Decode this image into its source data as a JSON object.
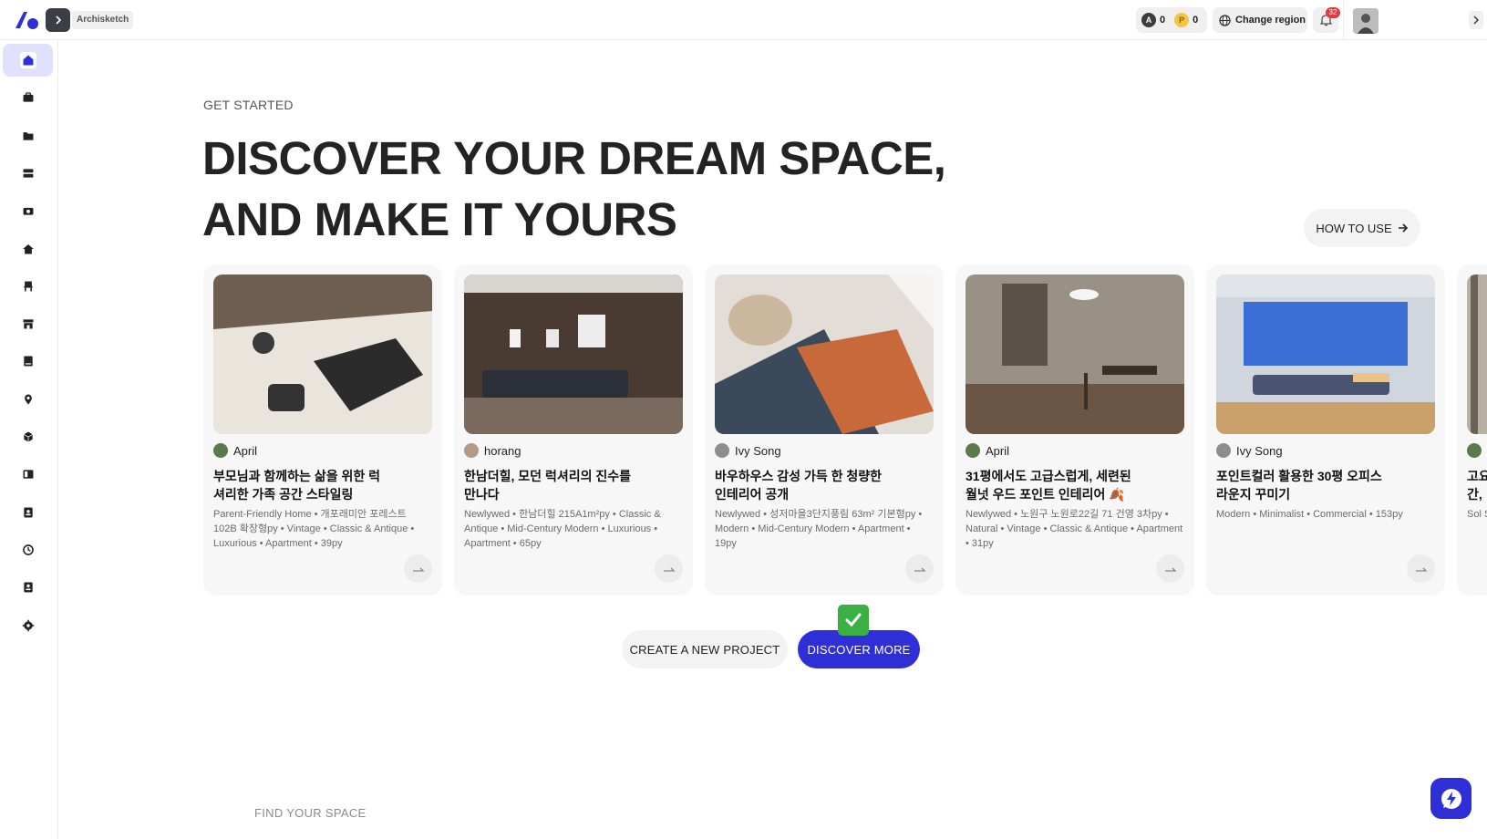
{
  "app": {
    "workspace_label": "Archisketch"
  },
  "topbar": {
    "credit_a_value": "0",
    "credit_p_letter": "P",
    "credit_p_value": "0",
    "region_label": "Change region",
    "notification_count": "32"
  },
  "sidebar": {
    "items": [
      {
        "icon": "home-icon",
        "active": true
      },
      {
        "icon": "briefcase-icon"
      },
      {
        "icon": "folder-icon"
      },
      {
        "icon": "storage-icon"
      },
      {
        "icon": "camera-icon"
      },
      {
        "icon": "house-icon"
      },
      {
        "icon": "chair-icon"
      },
      {
        "icon": "store-icon"
      },
      {
        "icon": "book-icon"
      },
      {
        "icon": "location-pin-icon"
      },
      {
        "icon": "cube-icon"
      },
      {
        "icon": "catalog-icon"
      },
      {
        "icon": "contact-card-icon"
      },
      {
        "icon": "history-icon"
      },
      {
        "icon": "id-badge-icon"
      },
      {
        "icon": "settings-icon"
      }
    ]
  },
  "hero": {
    "eyebrow": "GET STARTED",
    "headline_line1": "DISCOVER YOUR DREAM SPACE,",
    "headline_line2": "AND MAKE IT YOURS",
    "how_to_use": "HOW TO USE"
  },
  "cards": [
    {
      "author": "April",
      "title": "부모님과 함께하는 삶을 위한 럭셔리한 가족 공간 스타일링",
      "tags": "Parent-Friendly Home • 개포래미안 포레스트 102B 확장형py • Vintage • Classic & Antique • Luxurious • Apartment • 39py"
    },
    {
      "author": "horang",
      "title": "한남더힐, 모던 럭셔리의 진수를 만나다",
      "tags": "Newlywed • 한남더힐 215A1m²py • Classic & Antique • Mid-Century Modern • Luxurious • Apartment • 65py"
    },
    {
      "author": "Ivy Song",
      "title": "바우하우스 감성 가득 한 청량한 인테리어 공개",
      "tags": "Newlywed • 성저마을3단지풍림 63m² 기본형py • Modern • Mid-Century Modern • Apartment • 19py"
    },
    {
      "author": "April",
      "title": "31평에서도 고급스럽게, 세련된 월넛 우드 포인트 인테리어 🍂",
      "tags": "Newlywed • 노원구 노원로22길 71 건영 3차py • Natural • Vintage • Classic & Antique • Apartment • 31py"
    },
    {
      "author": "Ivy Song",
      "title": "포인트컬러 활용한 30평 오피스 라운지 꾸미기",
      "tags": "Modern • Minimalist • Commercial • 153py"
    }
  ],
  "peek_card": {
    "title": "고요 간,",
    "tags": "Sol Sin"
  },
  "actions": {
    "create": "CREATE A NEW PROJECT",
    "discover": "DISCOVER MORE"
  },
  "section_label": "FIND YOUR SPACE",
  "colors": {
    "accent": "#2f2fd8",
    "active_nav": "#dfe1ff",
    "badge": "#e03e3e",
    "check": "#3cb043"
  }
}
